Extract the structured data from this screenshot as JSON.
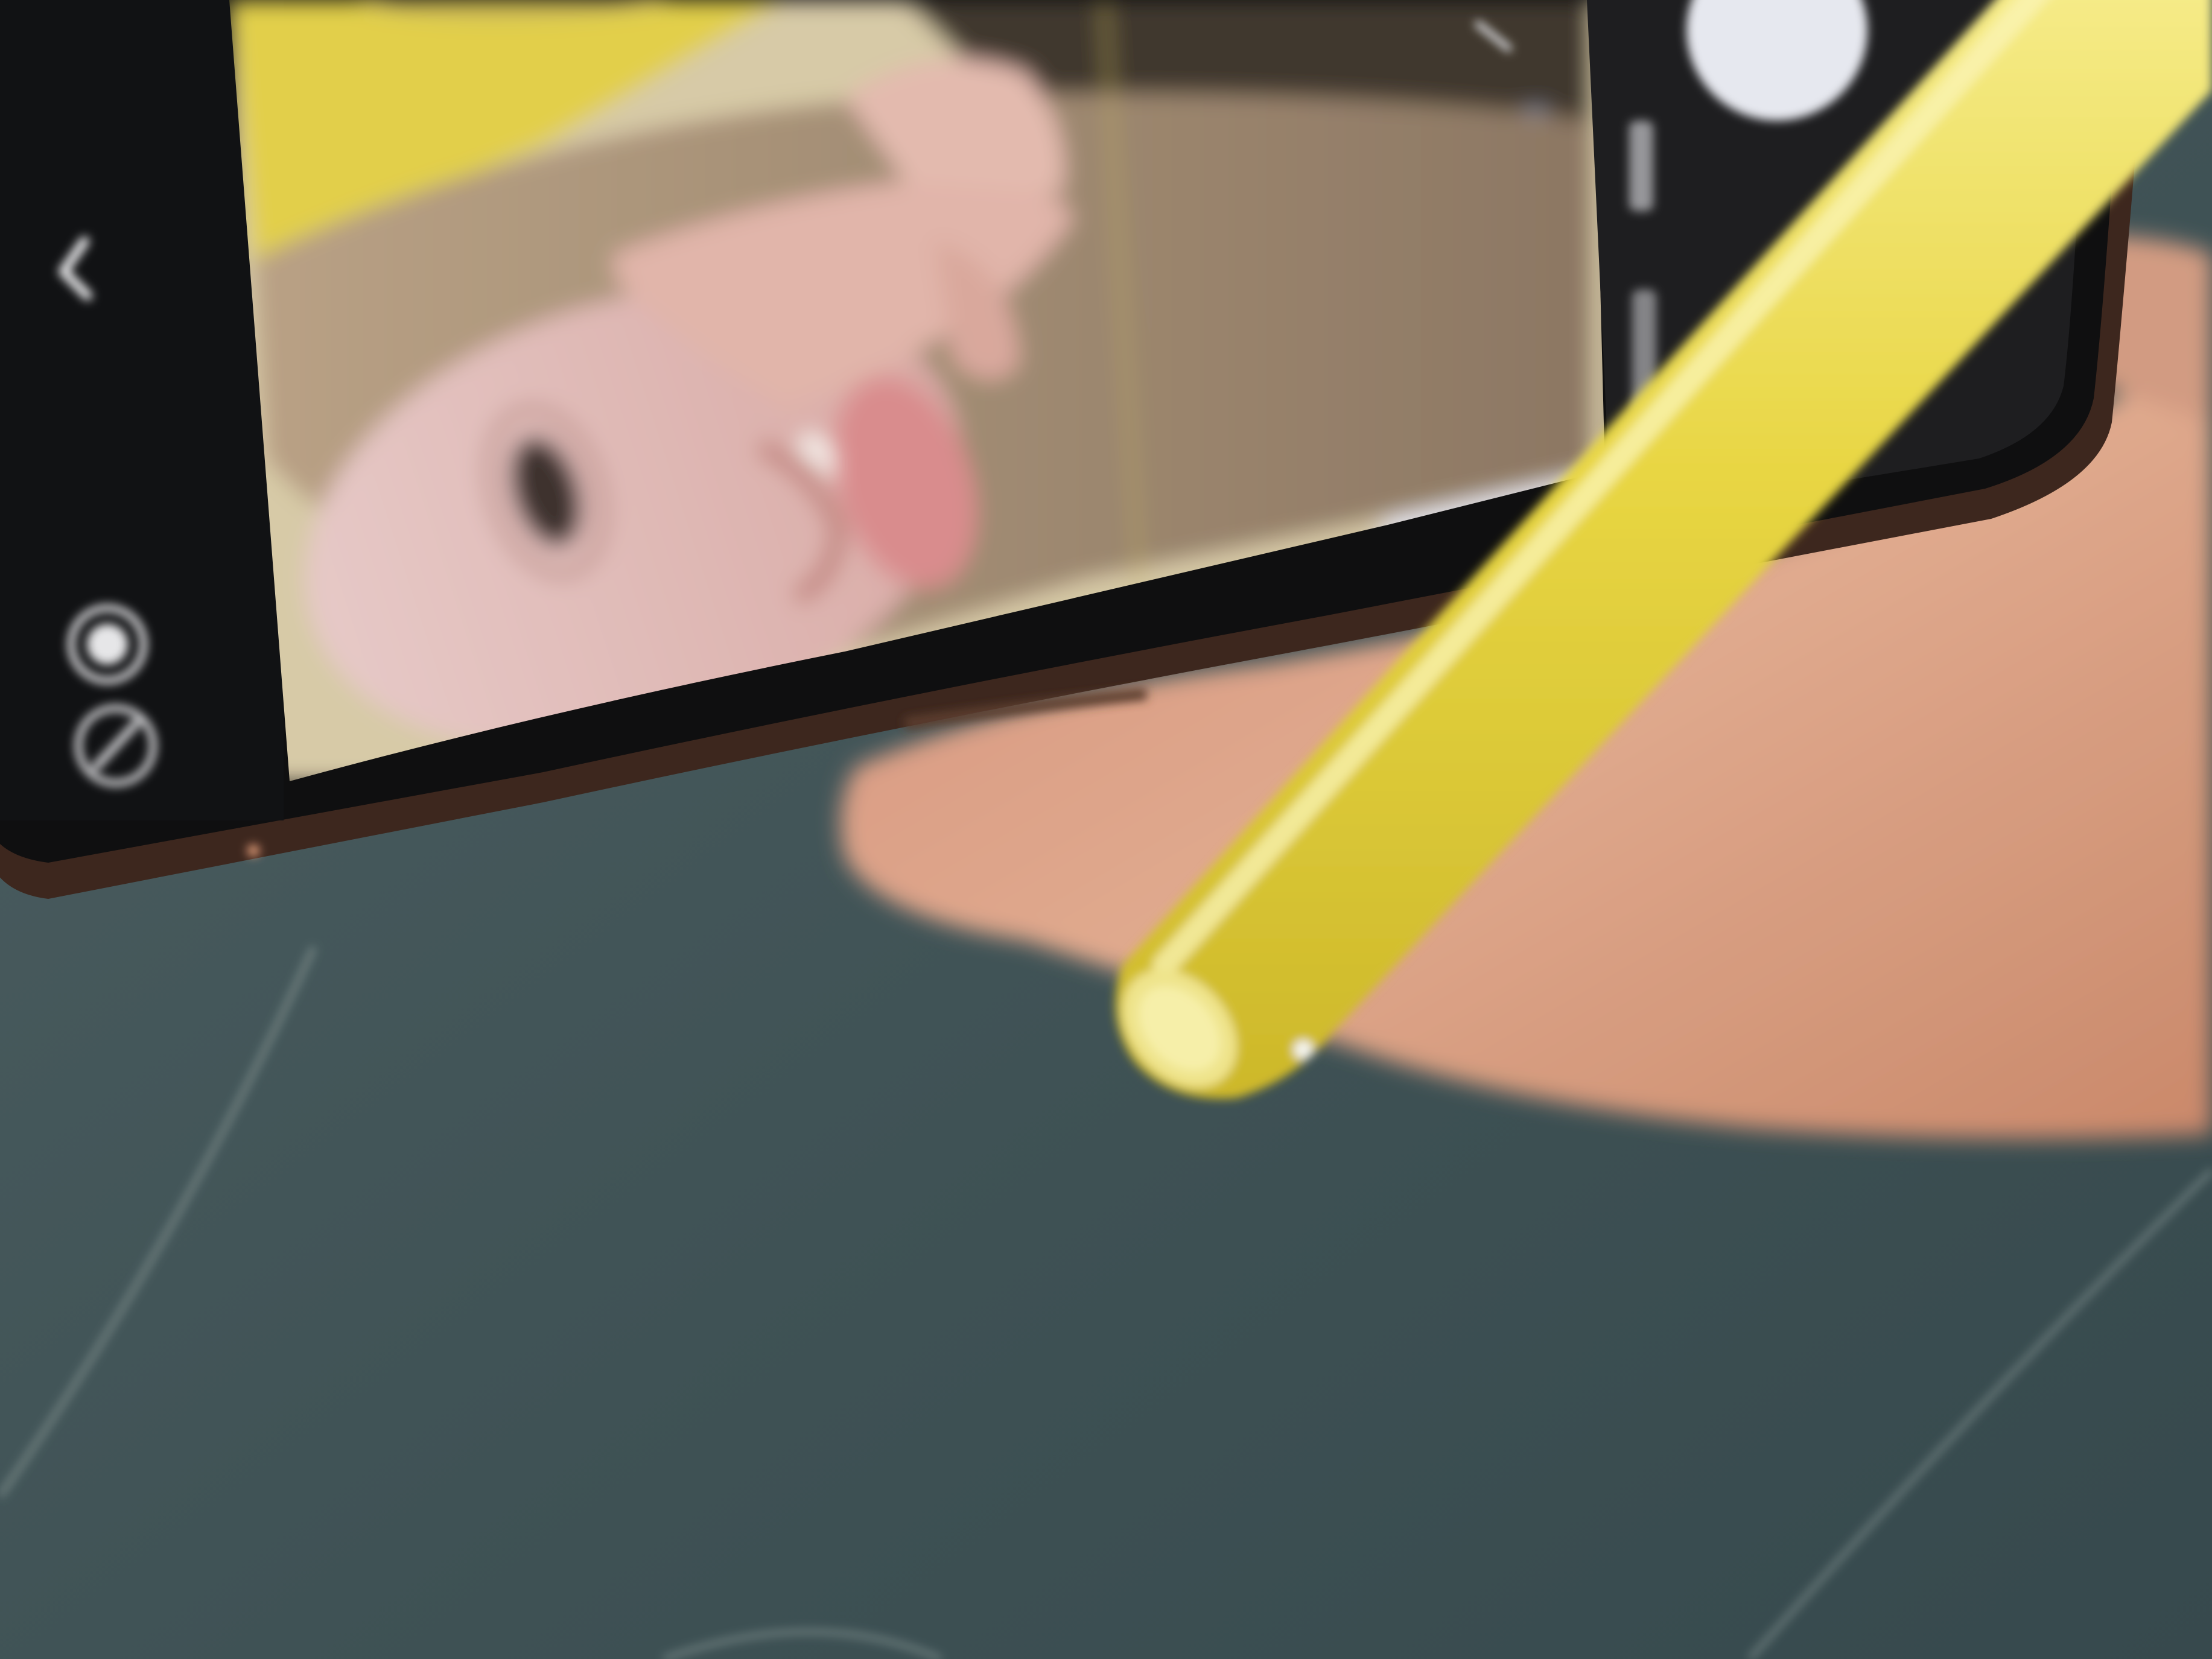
{
  "scene": {
    "description_tag": "photo",
    "colors": {
      "table_surface": "#3e5053",
      "table_surface_dark": "#34474a",
      "phone_body": "#2a1a14",
      "phone_screen_bezel": "#0b0b0c",
      "pen_yellow": "#e9d73f",
      "pen_yellow_light": "#f4e878",
      "skin": "#d99a7a",
      "backdrop_yellow": "#e2cf47"
    },
    "phone_ui": {
      "icons": [
        "back-chevron-icon",
        "shutter-circle-icon",
        "flash-off-icon",
        "capture-button-icon"
      ]
    }
  }
}
